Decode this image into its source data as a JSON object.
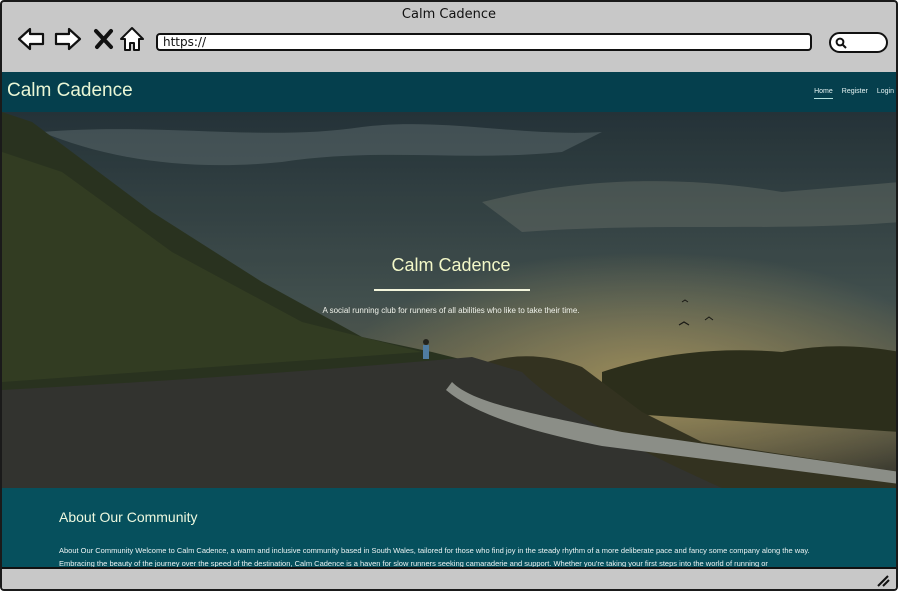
{
  "window": {
    "title": "Calm Cadence",
    "url": "https://"
  },
  "icons": {
    "back": "back-arrow-icon",
    "forward": "forward-arrow-icon",
    "close": "close-x-icon",
    "home": "home-icon",
    "search": "search-icon",
    "resize": "resize-grip-icon"
  },
  "site": {
    "brand": "Calm Cadence",
    "nav": [
      {
        "label": "Home",
        "active": true
      },
      {
        "label": "Register",
        "active": false
      },
      {
        "label": "Login",
        "active": false
      }
    ]
  },
  "hero": {
    "title": "Calm Cadence",
    "subtitle": "A social running club for runners of all abilities who like to take their time."
  },
  "about": {
    "heading": "About Our Community",
    "text": "About Our Community Welcome to Calm Cadence, a warm and inclusive community based in South Wales, tailored for those who find joy in the steady rhythm of a more deliberate pace and fancy some company along the way. Embracing the beauty of the journey over the speed of the destination, Calm Cadence is a haven for slow runners seeking camaraderie and support. Whether you're taking your first steps into the world of running or"
  },
  "colors": {
    "navbar": "#053f4d",
    "section": "#06505d",
    "accent_text": "#f3f8c8"
  }
}
